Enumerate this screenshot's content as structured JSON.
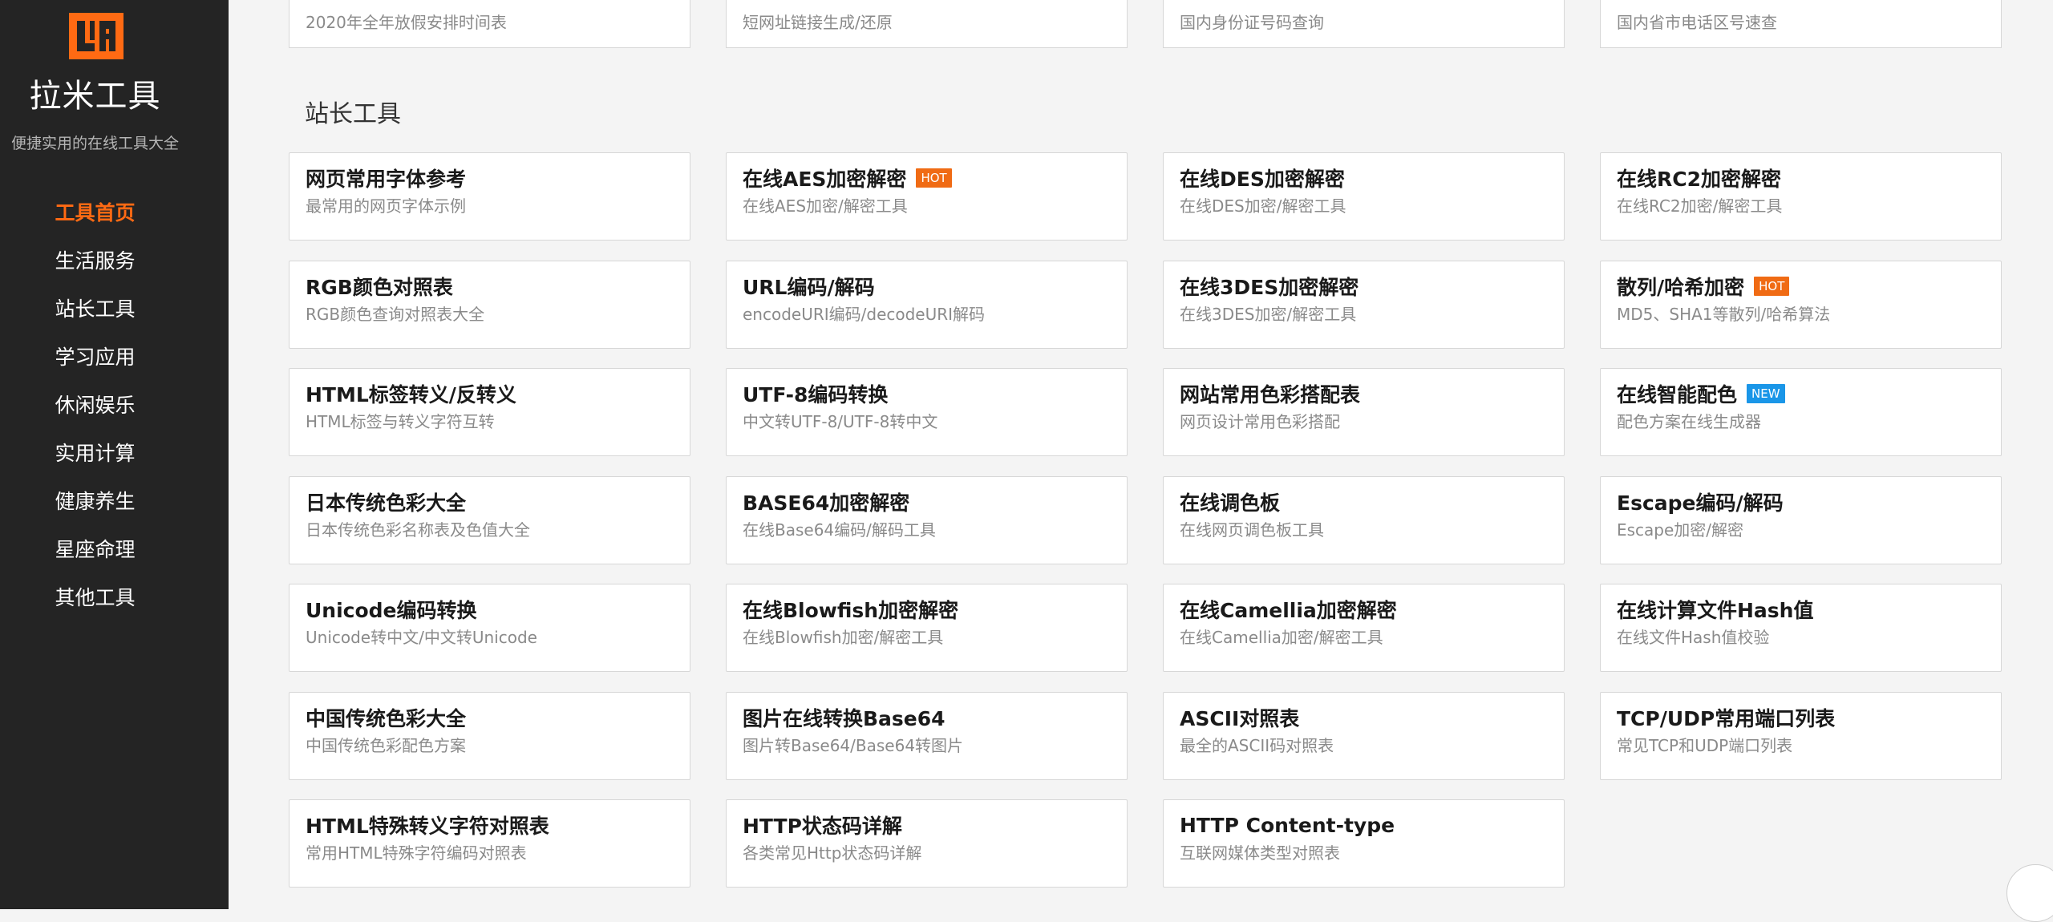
{
  "brand": {
    "name": "拉米工具",
    "tagline": "便捷实用的在线工具大全",
    "accent_color": "#ff6a13",
    "sidebar_color": "#242424"
  },
  "nav": [
    {
      "label": "工具首页",
      "active": true
    },
    {
      "label": "生活服务",
      "active": false
    },
    {
      "label": "站长工具",
      "active": false
    },
    {
      "label": "学习应用",
      "active": false
    },
    {
      "label": "休闲娱乐",
      "active": false
    },
    {
      "label": "实用计算",
      "active": false
    },
    {
      "label": "健康养生",
      "active": false
    },
    {
      "label": "星座命理",
      "active": false
    },
    {
      "label": "其他工具",
      "active": false
    }
  ],
  "prev_section": {
    "cards": [
      {
        "desc": "2020年全年放假安排时间表"
      },
      {
        "desc": "短网址链接生成/还原"
      },
      {
        "desc": "国内身份证号码查询"
      },
      {
        "desc": "国内省市电话区号速查"
      }
    ]
  },
  "section": {
    "title": "站长工具",
    "tools": [
      {
        "title": "网页常用字体参考",
        "desc": "最常用的网页字体示例",
        "badge": ""
      },
      {
        "title": "在线AES加密解密",
        "desc": "在线AES加密/解密工具",
        "badge": "HOT"
      },
      {
        "title": "在线DES加密解密",
        "desc": "在线DES加密/解密工具",
        "badge": ""
      },
      {
        "title": "在线RC2加密解密",
        "desc": "在线RC2加密/解密工具",
        "badge": ""
      },
      {
        "title": "RGB颜色对照表",
        "desc": "RGB颜色查询对照表大全",
        "badge": ""
      },
      {
        "title": "URL编码/解码",
        "desc": "encodeURI编码/decodeURI解码",
        "badge": ""
      },
      {
        "title": "在线3DES加密解密",
        "desc": "在线3DES加密/解密工具",
        "badge": ""
      },
      {
        "title": "散列/哈希加密",
        "desc": "MD5、SHA1等散列/哈希算法",
        "badge": "HOT"
      },
      {
        "title": "HTML标签转义/反转义",
        "desc": "HTML标签与转义字符互转",
        "badge": ""
      },
      {
        "title": "UTF-8编码转换",
        "desc": "中文转UTF-8/UTF-8转中文",
        "badge": ""
      },
      {
        "title": "网站常用色彩搭配表",
        "desc": "网页设计常用色彩搭配",
        "badge": ""
      },
      {
        "title": "在线智能配色",
        "desc": "配色方案在线生成器",
        "badge": "NEW"
      },
      {
        "title": "日本传统色彩大全",
        "desc": "日本传统色彩名称表及色值大全",
        "badge": ""
      },
      {
        "title": "BASE64加密解密",
        "desc": "在线Base64编码/解码工具",
        "badge": ""
      },
      {
        "title": "在线调色板",
        "desc": "在线网页调色板工具",
        "badge": ""
      },
      {
        "title": "Escape编码/解码",
        "desc": "Escape加密/解密",
        "badge": ""
      },
      {
        "title": "Unicode编码转换",
        "desc": "Unicode转中文/中文转Unicode",
        "badge": ""
      },
      {
        "title": "在线Blowfish加密解密",
        "desc": "在线Blowfish加密/解密工具",
        "badge": ""
      },
      {
        "title": "在线Camellia加密解密",
        "desc": "在线Camellia加密/解密工具",
        "badge": ""
      },
      {
        "title": "在线计算文件Hash值",
        "desc": "在线文件Hash值校验",
        "badge": ""
      },
      {
        "title": "中国传统色彩大全",
        "desc": "中国传统色彩配色方案",
        "badge": ""
      },
      {
        "title": "图片在线转换Base64",
        "desc": "图片转Base64/Base64转图片",
        "badge": ""
      },
      {
        "title": "ASCII对照表",
        "desc": "最全的ASCII码对照表",
        "badge": ""
      },
      {
        "title": "TCP/UDP常用端口列表",
        "desc": "常见TCP和UDP端口列表",
        "badge": ""
      },
      {
        "title": "HTML特殊转义字符对照表",
        "desc": "常用HTML特殊字符编码对照表",
        "badge": ""
      },
      {
        "title": "HTTP状态码详解",
        "desc": "各类常见Http状态码详解",
        "badge": ""
      },
      {
        "title": "HTTP Content-type",
        "desc": "互联网媒体类型对照表",
        "badge": ""
      }
    ]
  },
  "badge_colors": {
    "HOT": "#f06b14",
    "NEW": "#1a96e8"
  }
}
